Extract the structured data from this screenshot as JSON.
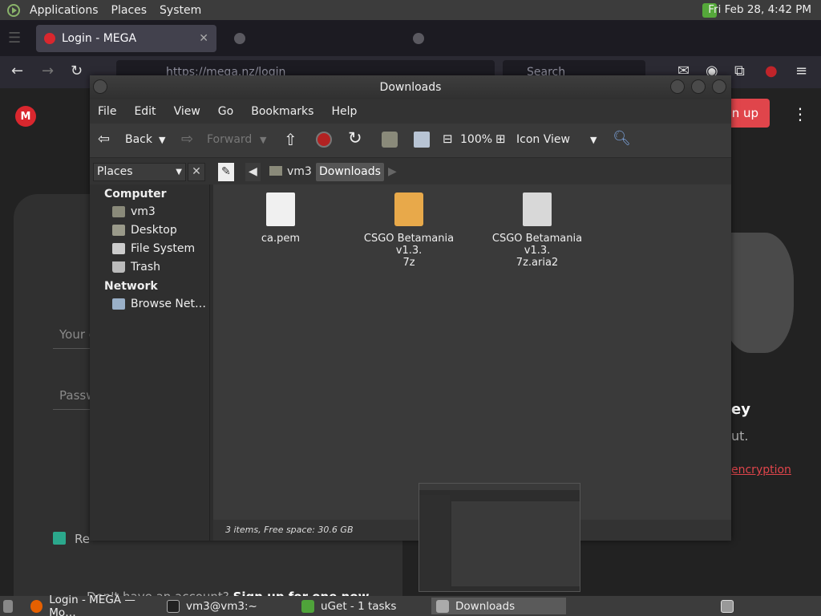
{
  "top_panel": {
    "menus": [
      "Applications",
      "Places",
      "System"
    ],
    "clock": "Fri Feb 28,  4:42 PM"
  },
  "browser": {
    "tabs": [
      {
        "label": "Login - MEGA",
        "active": true
      }
    ],
    "url": "https://mega.nz/login",
    "search_placeholder": "Search"
  },
  "mega_page": {
    "logo": "M",
    "signup_label": "gn up",
    "email_label": "Your e",
    "password_label": "Passw",
    "remember_label": "Re",
    "no_account_text": "Don't have an account?",
    "signup_link": "Sign up for one now",
    "heading_partial": "ey",
    "sub_partial": "ut.",
    "link_partial": "encryption"
  },
  "file_manager": {
    "title": "Downloads",
    "menu": [
      "File",
      "Edit",
      "View",
      "Go",
      "Bookmarks",
      "Help"
    ],
    "toolbar": {
      "back": "Back",
      "forward": "Forward",
      "zoom": "100%",
      "view_mode": "Icon View"
    },
    "places_combo": "Places",
    "breadcrumbs": [
      "vm3",
      "Downloads"
    ],
    "sidebar": {
      "computer_heading": "Computer",
      "computer_items": [
        "vm3",
        "Desktop",
        "File System",
        "Trash"
      ],
      "network_heading": "Network",
      "network_items": [
        "Browse Net…"
      ]
    },
    "files": [
      {
        "name": "ca.pem",
        "icon": "text-file-icon"
      },
      {
        "name": "CSGO Betamania v1.3.7z",
        "line1": "CSGO Betamania v1.3.",
        "line2": "7z",
        "icon": "archive-icon"
      },
      {
        "name": "CSGO Betamania v1.3.7z.aria2",
        "line1": "CSGO Betamania v1.3.",
        "line2": "7z.aria2",
        "icon": "clock-file-icon"
      }
    ],
    "status": "3 items, Free space: 30.6 GB"
  },
  "taskbar": {
    "tasks": [
      {
        "label": "Login - MEGA — Mo…"
      },
      {
        "label": "vm3@vm3:~"
      },
      {
        "label": "uGet - 1 tasks"
      },
      {
        "label": "Downloads",
        "active": true
      }
    ]
  },
  "colors": {
    "mega_red": "#d9272e",
    "accent_green": "#2ba88c"
  }
}
